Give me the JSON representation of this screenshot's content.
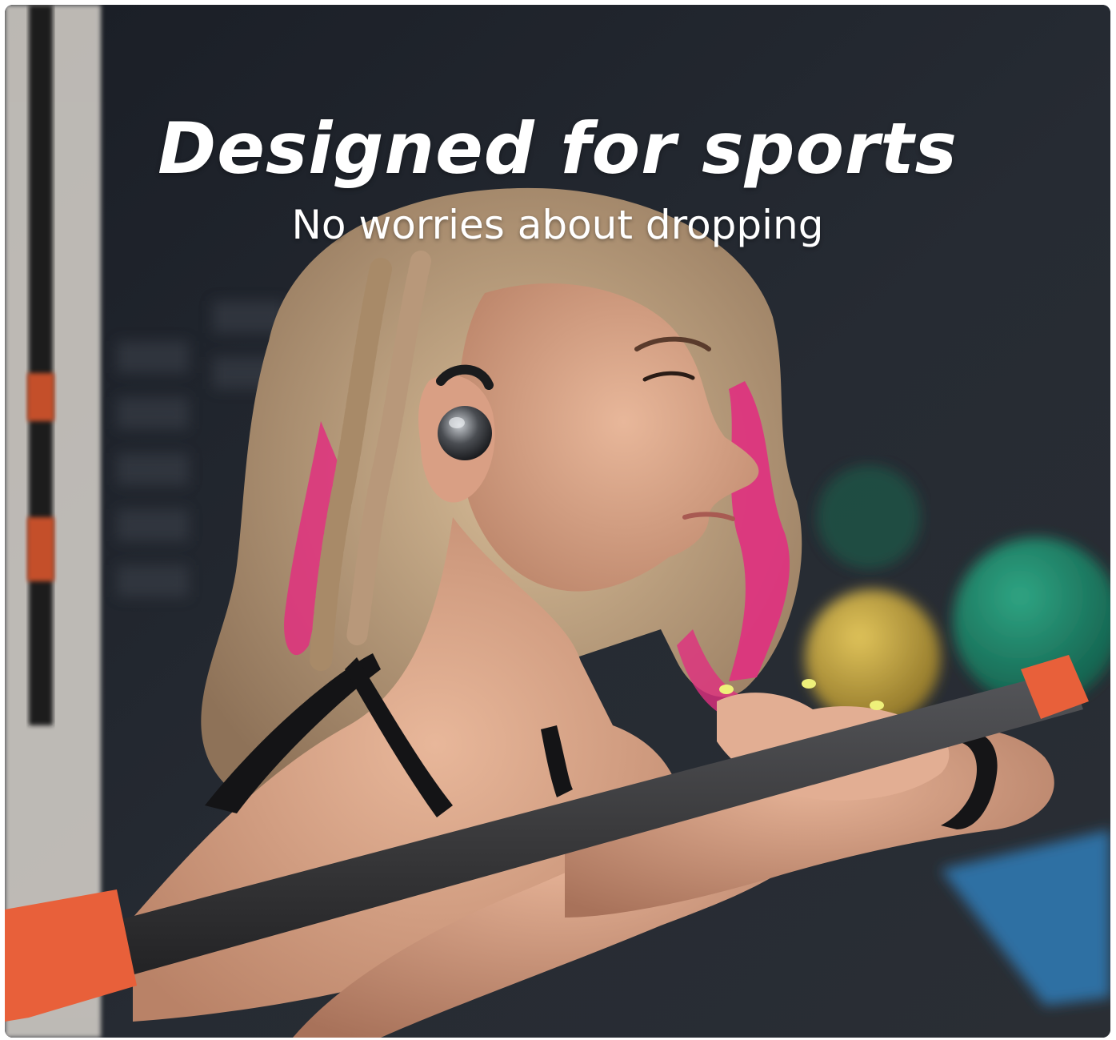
{
  "banner": {
    "headline": "Designed for sports",
    "subline": "No worries about dropping"
  },
  "colors": {
    "text": "#ffffff",
    "hair_blonde": "#c9ab86",
    "hair_pink": "#e0307f",
    "bar": "#3a3a3c",
    "bar_end_caps": "#e8603a",
    "background_dark": "#1c212a",
    "exercise_ball_green": "#1f8a70",
    "exercise_ball_yellow": "#c9a93a",
    "floor_mat_blue": "#2d6fa3"
  },
  "icons": {
    "earbud": "earbud-icon"
  }
}
